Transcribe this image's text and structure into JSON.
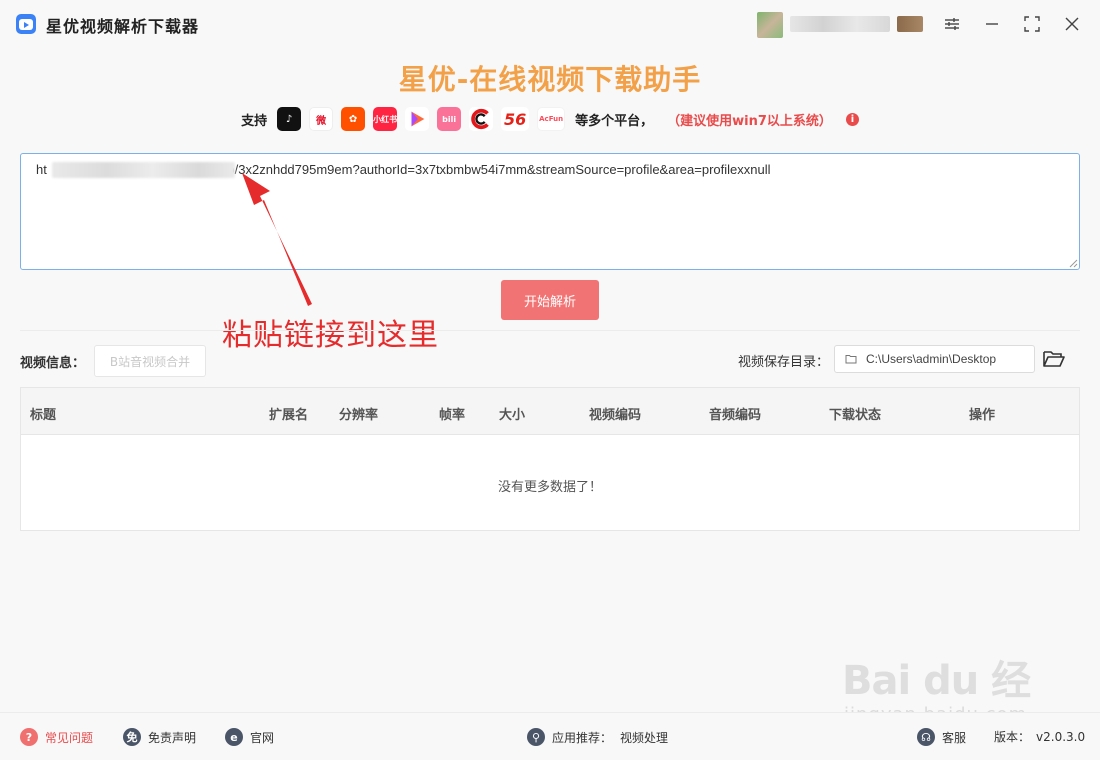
{
  "window": {
    "title": "星优视频解析下载器"
  },
  "header": {
    "headline": "星优-在线视频下载助手",
    "support_label": "支持",
    "platforms": [
      {
        "name": "douyin",
        "text": "♪"
      },
      {
        "name": "weibo",
        "text": "微"
      },
      {
        "name": "kuaishou",
        "text": "✿"
      },
      {
        "name": "xiaohongshu",
        "text": "小红书"
      },
      {
        "name": "xigua",
        "text": "▶"
      },
      {
        "name": "bilibili",
        "text": "bili"
      },
      {
        "name": "cctv",
        "text": "C"
      },
      {
        "name": "56",
        "text": "56"
      },
      {
        "name": "acfun",
        "text": "AcFun"
      }
    ],
    "multi_platform": "等多个平台，",
    "system_tip": "（建议使用win7以上系统）"
  },
  "url_input": {
    "value": "ht                                        rt-video/3x2znhdd795m9em?authorId=3x7txbmbw54i7mm&streamSource=profile&area=profilexxnull"
  },
  "parse_button": {
    "label": "开始解析"
  },
  "annotation": {
    "text": "粘贴链接到这里",
    "color": "#e52b2b"
  },
  "video_info": {
    "label": "视频信息：",
    "merge_button": "B站音视频合并"
  },
  "save_dir": {
    "label": "视频保存目录：",
    "path": "C:\\Users\\admin\\Desktop"
  },
  "table": {
    "columns": [
      "标题",
      "扩展名",
      "分辨率",
      "帧率",
      "大小",
      "视频编码",
      "音频编码",
      "下载状态",
      "操作"
    ],
    "empty_message": "没有更多数据了！"
  },
  "watermark": {
    "main": "Bai du 经验",
    "sub": "jingyan.baidu.com"
  },
  "footer": {
    "faq": "常见问题",
    "disclaimer": "免责声明",
    "website": "官网",
    "recommend_label": "应用推荐：",
    "recommend_value": "视频处理",
    "support": "客服",
    "version_label": "版本：",
    "version": "v2.0.3.0"
  },
  "colors": {
    "accent": "#f27373",
    "headline": "#f3a148",
    "tip": "#e94b4b",
    "input_border": "#7cb0e8"
  }
}
